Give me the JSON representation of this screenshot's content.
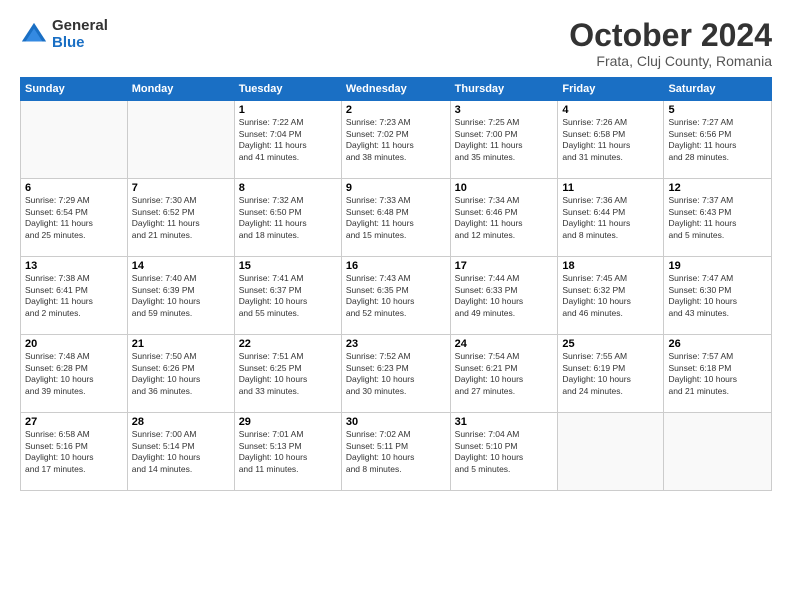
{
  "logo": {
    "general": "General",
    "blue": "Blue"
  },
  "header": {
    "month": "October 2024",
    "location": "Frata, Cluj County, Romania"
  },
  "weekdays": [
    "Sunday",
    "Monday",
    "Tuesday",
    "Wednesday",
    "Thursday",
    "Friday",
    "Saturday"
  ],
  "weeks": [
    [
      {
        "day": "",
        "info": ""
      },
      {
        "day": "",
        "info": ""
      },
      {
        "day": "1",
        "info": "Sunrise: 7:22 AM\nSunset: 7:04 PM\nDaylight: 11 hours\nand 41 minutes."
      },
      {
        "day": "2",
        "info": "Sunrise: 7:23 AM\nSunset: 7:02 PM\nDaylight: 11 hours\nand 38 minutes."
      },
      {
        "day": "3",
        "info": "Sunrise: 7:25 AM\nSunset: 7:00 PM\nDaylight: 11 hours\nand 35 minutes."
      },
      {
        "day": "4",
        "info": "Sunrise: 7:26 AM\nSunset: 6:58 PM\nDaylight: 11 hours\nand 31 minutes."
      },
      {
        "day": "5",
        "info": "Sunrise: 7:27 AM\nSunset: 6:56 PM\nDaylight: 11 hours\nand 28 minutes."
      }
    ],
    [
      {
        "day": "6",
        "info": "Sunrise: 7:29 AM\nSunset: 6:54 PM\nDaylight: 11 hours\nand 25 minutes."
      },
      {
        "day": "7",
        "info": "Sunrise: 7:30 AM\nSunset: 6:52 PM\nDaylight: 11 hours\nand 21 minutes."
      },
      {
        "day": "8",
        "info": "Sunrise: 7:32 AM\nSunset: 6:50 PM\nDaylight: 11 hours\nand 18 minutes."
      },
      {
        "day": "9",
        "info": "Sunrise: 7:33 AM\nSunset: 6:48 PM\nDaylight: 11 hours\nand 15 minutes."
      },
      {
        "day": "10",
        "info": "Sunrise: 7:34 AM\nSunset: 6:46 PM\nDaylight: 11 hours\nand 12 minutes."
      },
      {
        "day": "11",
        "info": "Sunrise: 7:36 AM\nSunset: 6:44 PM\nDaylight: 11 hours\nand 8 minutes."
      },
      {
        "day": "12",
        "info": "Sunrise: 7:37 AM\nSunset: 6:43 PM\nDaylight: 11 hours\nand 5 minutes."
      }
    ],
    [
      {
        "day": "13",
        "info": "Sunrise: 7:38 AM\nSunset: 6:41 PM\nDaylight: 11 hours\nand 2 minutes."
      },
      {
        "day": "14",
        "info": "Sunrise: 7:40 AM\nSunset: 6:39 PM\nDaylight: 10 hours\nand 59 minutes."
      },
      {
        "day": "15",
        "info": "Sunrise: 7:41 AM\nSunset: 6:37 PM\nDaylight: 10 hours\nand 55 minutes."
      },
      {
        "day": "16",
        "info": "Sunrise: 7:43 AM\nSunset: 6:35 PM\nDaylight: 10 hours\nand 52 minutes."
      },
      {
        "day": "17",
        "info": "Sunrise: 7:44 AM\nSunset: 6:33 PM\nDaylight: 10 hours\nand 49 minutes."
      },
      {
        "day": "18",
        "info": "Sunrise: 7:45 AM\nSunset: 6:32 PM\nDaylight: 10 hours\nand 46 minutes."
      },
      {
        "day": "19",
        "info": "Sunrise: 7:47 AM\nSunset: 6:30 PM\nDaylight: 10 hours\nand 43 minutes."
      }
    ],
    [
      {
        "day": "20",
        "info": "Sunrise: 7:48 AM\nSunset: 6:28 PM\nDaylight: 10 hours\nand 39 minutes."
      },
      {
        "day": "21",
        "info": "Sunrise: 7:50 AM\nSunset: 6:26 PM\nDaylight: 10 hours\nand 36 minutes."
      },
      {
        "day": "22",
        "info": "Sunrise: 7:51 AM\nSunset: 6:25 PM\nDaylight: 10 hours\nand 33 minutes."
      },
      {
        "day": "23",
        "info": "Sunrise: 7:52 AM\nSunset: 6:23 PM\nDaylight: 10 hours\nand 30 minutes."
      },
      {
        "day": "24",
        "info": "Sunrise: 7:54 AM\nSunset: 6:21 PM\nDaylight: 10 hours\nand 27 minutes."
      },
      {
        "day": "25",
        "info": "Sunrise: 7:55 AM\nSunset: 6:19 PM\nDaylight: 10 hours\nand 24 minutes."
      },
      {
        "day": "26",
        "info": "Sunrise: 7:57 AM\nSunset: 6:18 PM\nDaylight: 10 hours\nand 21 minutes."
      }
    ],
    [
      {
        "day": "27",
        "info": "Sunrise: 6:58 AM\nSunset: 5:16 PM\nDaylight: 10 hours\nand 17 minutes."
      },
      {
        "day": "28",
        "info": "Sunrise: 7:00 AM\nSunset: 5:14 PM\nDaylight: 10 hours\nand 14 minutes."
      },
      {
        "day": "29",
        "info": "Sunrise: 7:01 AM\nSunset: 5:13 PM\nDaylight: 10 hours\nand 11 minutes."
      },
      {
        "day": "30",
        "info": "Sunrise: 7:02 AM\nSunset: 5:11 PM\nDaylight: 10 hours\nand 8 minutes."
      },
      {
        "day": "31",
        "info": "Sunrise: 7:04 AM\nSunset: 5:10 PM\nDaylight: 10 hours\nand 5 minutes."
      },
      {
        "day": "",
        "info": ""
      },
      {
        "day": "",
        "info": ""
      }
    ]
  ]
}
